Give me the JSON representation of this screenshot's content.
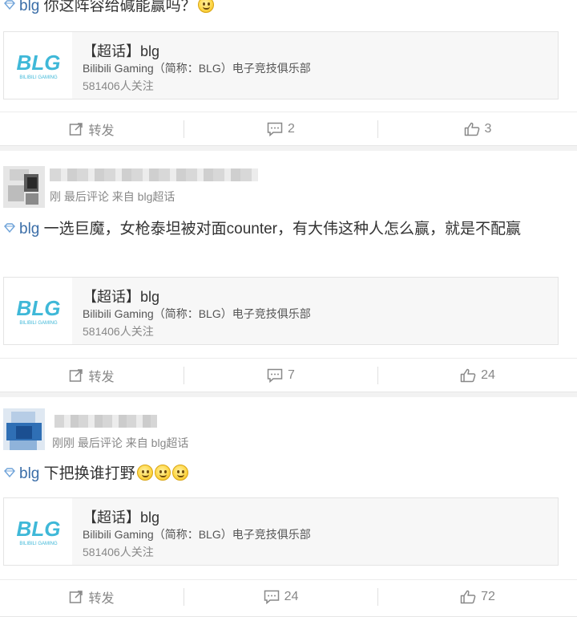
{
  "posts": [
    {
      "topic": "blg",
      "text": " 你这阵容给碱能赢吗？",
      "emoji_count": 1,
      "card": {
        "title": "【超话】blg",
        "desc": "Bilibili Gaming（简称：BLG）电子竞技俱乐部",
        "followers": "581406人关注"
      },
      "actions": {
        "repost": "转发",
        "comments": "2",
        "likes": "3"
      }
    },
    {
      "meta": "刚 最后评论 来自 blg超话",
      "topic": "blg",
      "text": " 一选巨魔，女枪泰坦被对面counter，有大伟这种人怎么赢，就是不配赢",
      "card": {
        "title": "【超话】blg",
        "desc": "Bilibili Gaming（简称：BLG）电子竞技俱乐部",
        "followers": "581406人关注"
      },
      "actions": {
        "repost": "转发",
        "comments": "7",
        "likes": "24"
      }
    },
    {
      "meta": "刚刚 最后评论 来自 blg超话",
      "topic": "blg",
      "text": " 下把换谁打野",
      "emoji_count": 3,
      "card": {
        "title": "【超话】blg",
        "desc": "Bilibili Gaming（简称：BLG）电子竞技俱乐部",
        "followers": "581406人关注"
      },
      "actions": {
        "repost": "转发",
        "comments": "24",
        "likes": "72"
      }
    }
  ],
  "logo_text": {
    "main": "BLG",
    "sub": "BILIBILI GAMING"
  },
  "colors": {
    "link": "#3b6ea8",
    "logo": "#3fb8d8",
    "action": "#888888"
  }
}
